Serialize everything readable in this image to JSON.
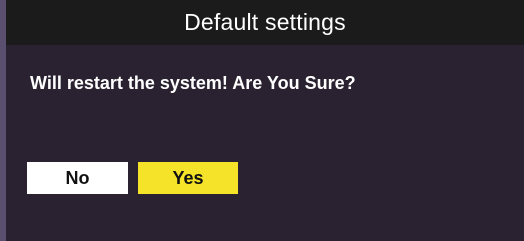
{
  "dialog": {
    "title": "Default settings",
    "message": "Will restart the system! Are You Sure?",
    "buttons": {
      "no_label": "No",
      "yes_label": "Yes"
    },
    "selected_button": "Yes",
    "colors": {
      "title_background": "#1b1b1b",
      "body_background": "#2a2230",
      "selected_highlight": "#f5e32a",
      "unselected_button": "#ffffff",
      "text": "#ffffff"
    }
  }
}
